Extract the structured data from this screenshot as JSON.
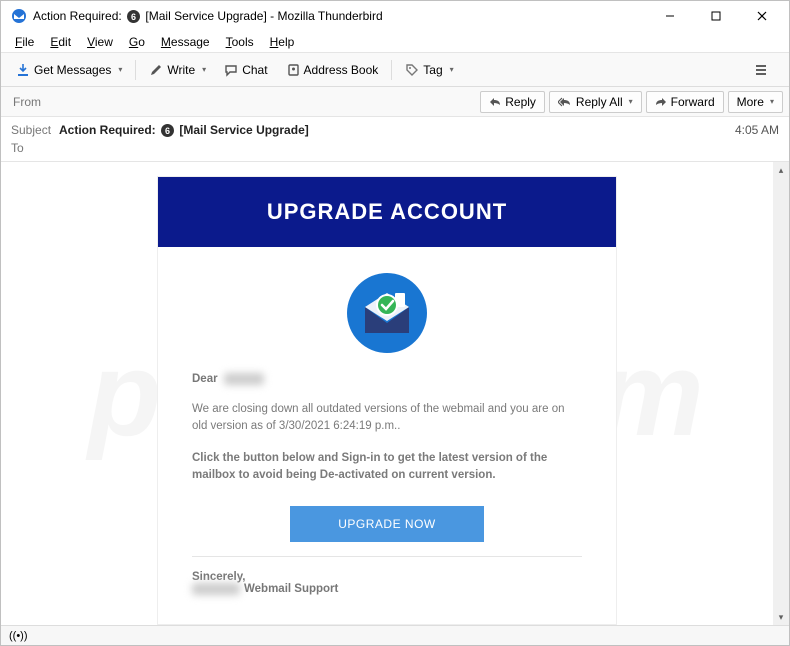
{
  "window": {
    "title": "Action Required: ⓬ [Mail Service Upgrade] - Mozilla Thunderbird"
  },
  "menubar": [
    "File",
    "Edit",
    "View",
    "Go",
    "Message",
    "Tools",
    "Help"
  ],
  "toolbar": {
    "get_messages": "Get Messages",
    "write": "Write",
    "chat": "Chat",
    "address_book": "Address Book",
    "tag": "Tag"
  },
  "actions": {
    "reply": "Reply",
    "reply_all": "Reply All",
    "forward": "Forward",
    "more": "More"
  },
  "headers": {
    "from_label": "From",
    "subject_label": "Subject",
    "to_label": "To",
    "subject_prefix": "Action Required:",
    "subject_suffix": "[Mail Service Upgrade]",
    "time": "4:05 AM"
  },
  "email": {
    "banner": "UPGRADE ACCOUNT",
    "greeting": "Dear",
    "p1": "We are closing down all outdated versions of the webmail and you are on old version as of 3/30/2021 6:24:19 p.m..",
    "p2": "Click the button below and Sign-in to get the latest version of the mailbox to avoid being De-activated on current version.",
    "cta": "UPGRADE NOW",
    "signoff": "Sincerely,",
    "support_suffix": "Webmail Support"
  },
  "subject_badge": "6",
  "watermark": "pcrisk.com"
}
